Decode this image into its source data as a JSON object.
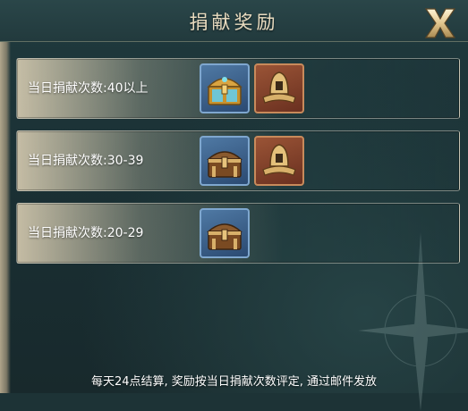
{
  "dialog": {
    "title": "捐献奖励",
    "close_label": "X",
    "footer_note": "每天24点结算, 奖励按当日捐献次数评定, 通过邮件发放"
  },
  "reward_tiers": [
    {
      "label": "当日捐献次数:40以上",
      "items": [
        {
          "icon": "jeweled-treasure-chest-icon",
          "frame": "blue"
        },
        {
          "icon": "golden-helmet-icon",
          "frame": "red"
        }
      ]
    },
    {
      "label": "当日捐献次数:30-39",
      "items": [
        {
          "icon": "bronze-treasure-chest-icon",
          "frame": "blue"
        },
        {
          "icon": "golden-helmet-icon",
          "frame": "red"
        }
      ]
    },
    {
      "label": "当日捐献次数:20-29",
      "items": [
        {
          "icon": "bronze-treasure-chest-icon",
          "frame": "blue"
        }
      ]
    }
  ],
  "colors": {
    "title_text": "#e9dcc0",
    "blue_frame": "#7fa7cf",
    "red_frame": "#c88a5b"
  }
}
